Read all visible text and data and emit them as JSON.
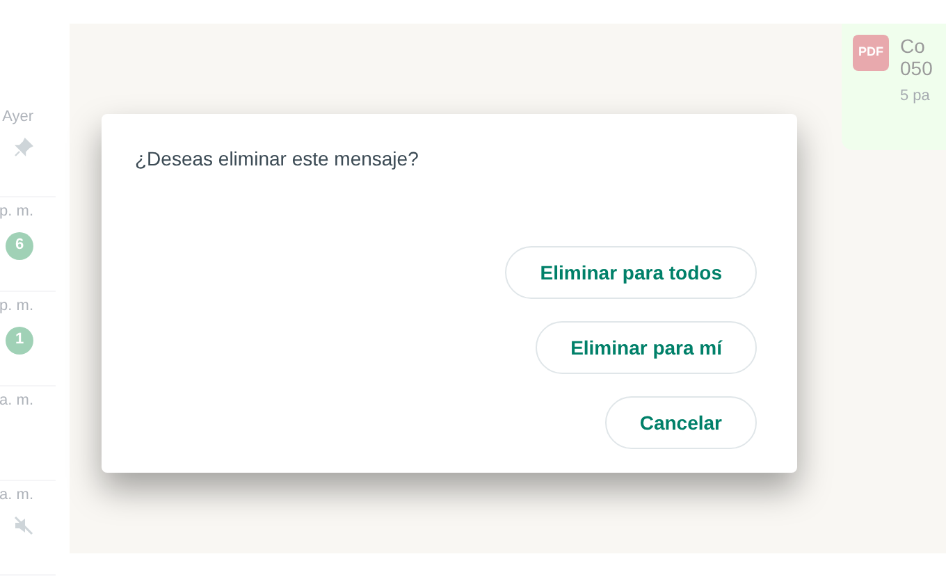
{
  "chat_list": [
    {
      "time": "Ayer",
      "kind": "pinned"
    },
    {
      "time": "p. m.",
      "kind": "unread",
      "badge": "6"
    },
    {
      "time": "p. m.",
      "kind": "unread",
      "badge": "1"
    },
    {
      "time": "a. m.",
      "kind": "plain"
    },
    {
      "time": "a. m.",
      "kind": "muted"
    }
  ],
  "document_message": {
    "file_type": "PDF",
    "title": "Co",
    "subtitle": "050",
    "meta": "5 pa"
  },
  "dialog": {
    "message": "¿Deseas eliminar este mensaje?",
    "buttons": [
      "Eliminar para todos",
      "Eliminar para mí",
      "Cancelar"
    ]
  }
}
